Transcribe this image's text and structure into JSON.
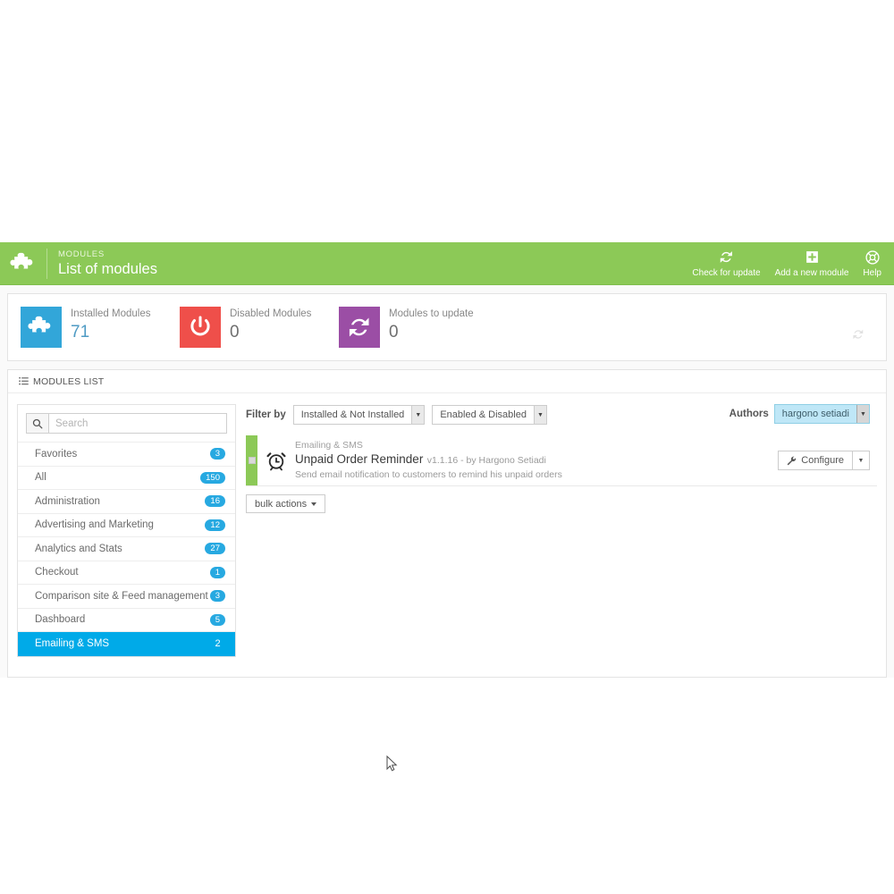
{
  "header": {
    "kicker": "MODULES",
    "title": "List of modules",
    "logo_icon": "puzzle-piece-icon",
    "actions": [
      {
        "label": "Check for update",
        "icon": "refresh-icon"
      },
      {
        "label": "Add a new module",
        "icon": "plus-square-icon"
      },
      {
        "label": "Help",
        "icon": "lifebuoy-icon"
      }
    ]
  },
  "stats": {
    "refresh_icon": "refresh-icon",
    "items": [
      {
        "label": "Installed Modules",
        "value": "71",
        "icon": "puzzle-piece-icon",
        "color": "#32a6d9"
      },
      {
        "label": "Disabled Modules",
        "value": "0",
        "icon": "power-off-icon",
        "color": "#ef4f4a"
      },
      {
        "label": "Modules to update",
        "value": "0",
        "icon": "refresh-icon",
        "color": "#9b4ea5"
      }
    ]
  },
  "modules_list": {
    "panel_title": "MODULES LIST",
    "panel_icon": "list-icon",
    "search": {
      "placeholder": "Search",
      "value": "",
      "icon": "search-icon"
    },
    "categories": [
      {
        "label": "Favorites",
        "count": "3",
        "active": false
      },
      {
        "label": "All",
        "count": "150",
        "active": false
      },
      {
        "label": "Administration",
        "count": "16",
        "active": false
      },
      {
        "label": "Advertising and Marketing",
        "count": "12",
        "active": false
      },
      {
        "label": "Analytics and Stats",
        "count": "27",
        "active": false
      },
      {
        "label": "Checkout",
        "count": "1",
        "active": false
      },
      {
        "label": "Comparison site & Feed management",
        "count": "3",
        "active": false
      },
      {
        "label": "Dashboard",
        "count": "5",
        "active": false
      },
      {
        "label": "Emailing & SMS",
        "count": "2",
        "active": true
      }
    ],
    "filter": {
      "label": "Filter by",
      "install_select": "Installed & Not Installed",
      "enable_select": "Enabled & Disabled",
      "authors_label": "Authors",
      "authors_select": "hargono setiadi"
    },
    "rows": [
      {
        "category": "Emailing & SMS",
        "name": "Unpaid Order Reminder",
        "meta": "v1.1.16 - by Hargono Setiadi",
        "description": "Send email notification to customers to remind his unpaid orders",
        "icon": "alarm-clock-icon",
        "status_color": "#8cc957",
        "action_label": "Configure",
        "action_icon": "wrench-icon"
      }
    ],
    "bulk_actions_label": "bulk actions"
  },
  "colors": {
    "header_green": "#8cc957",
    "accent_blue": "#00aae8",
    "badge_blue": "#27a9e1",
    "danger_red": "#ef4f4a",
    "purple": "#9b4ea5"
  }
}
